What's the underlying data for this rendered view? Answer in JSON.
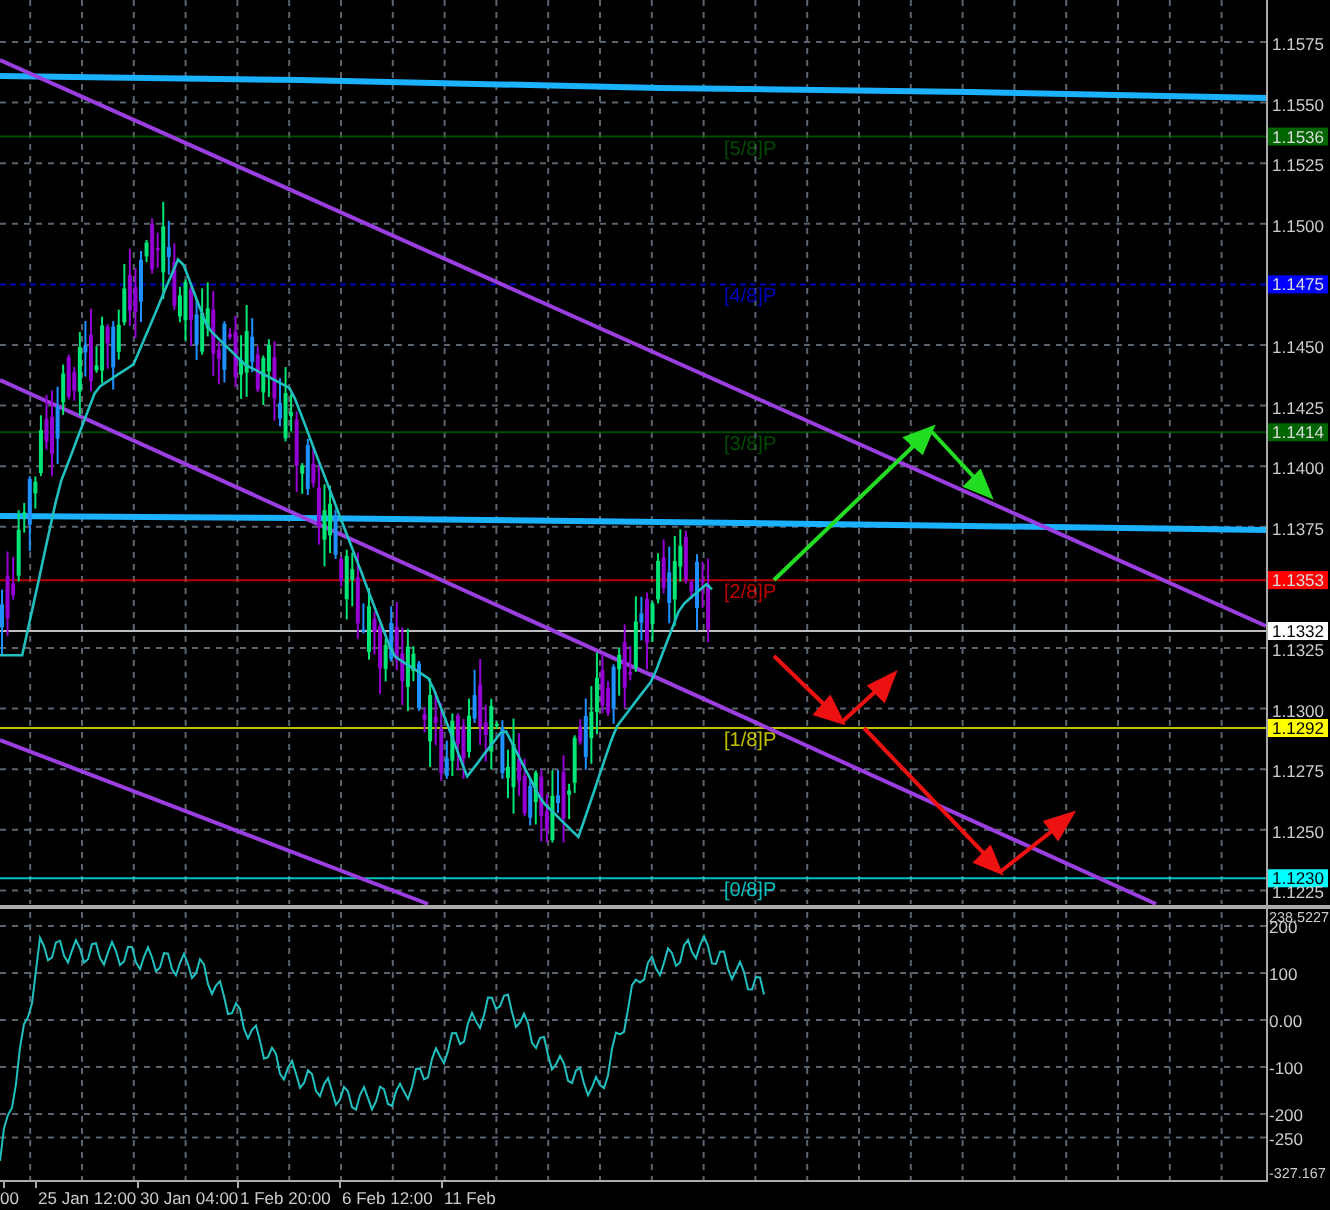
{
  "price_axis": {
    "ticks": [
      "1.1575",
      "1.1550",
      "1.1525",
      "1.1500",
      "1.1450",
      "1.1425",
      "1.1400",
      "1.1375",
      "1.1325",
      "1.1300",
      "1.1275",
      "1.1250",
      "1.1225"
    ],
    "markers": [
      {
        "value": "1.1536",
        "label": "[5/8]P",
        "color": "#006400"
      },
      {
        "value": "1.1475",
        "label": "[4/8]P",
        "color": "#0000ff"
      },
      {
        "value": "1.1414",
        "label": "[3/8]P",
        "color": "#006400"
      },
      {
        "value": "1.1353",
        "label": "[2/8]P",
        "color": "#ff0000"
      },
      {
        "value": "1.1332",
        "color": "#ffffff"
      },
      {
        "value": "1.1292",
        "label": "[1/8]P",
        "color": "#ffff00"
      },
      {
        "value": "1.1230",
        "label": "[0/8]P",
        "color": "#00ffff"
      }
    ]
  },
  "oscillator_axis": {
    "labels": [
      "238.5227",
      "200",
      "100",
      "0.00",
      "-100",
      "-200",
      "-250",
      "-327.167"
    ]
  },
  "time_axis": {
    "labels": [
      "00",
      "25 Jan 12:00",
      "30 Jan 04:00",
      "1 Feb 20:00",
      "6 Feb 12:00",
      "11 Feb"
    ]
  }
}
